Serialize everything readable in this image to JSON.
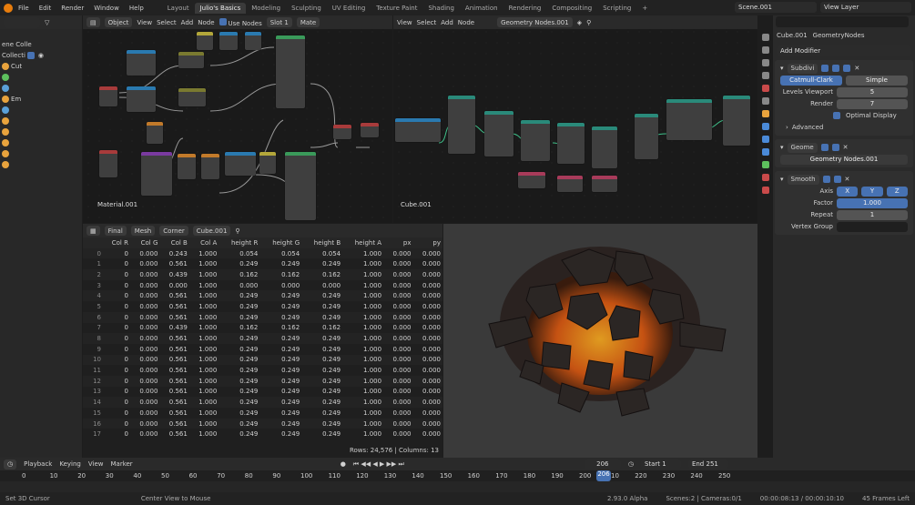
{
  "menu": [
    "File",
    "Edit",
    "Render",
    "Window",
    "Help"
  ],
  "tabs": [
    "Layout",
    "Julio's Basics",
    "Modeling",
    "Sculpting",
    "UV Editing",
    "Texture Paint",
    "Shading",
    "Animation",
    "Rendering",
    "Compositing",
    "Scripting"
  ],
  "scene": "Scene.001",
  "view_layer": "View Layer",
  "outliner": {
    "rows": [
      "ene Colle",
      "Collecti",
      "Cut",
      "",
      "",
      "Em",
      "",
      "",
      "",
      "",
      "",
      ""
    ]
  },
  "shader_editor": {
    "mode": "Object",
    "menus": [
      "View",
      "Select",
      "Add",
      "Node"
    ],
    "use_nodes": "Use Nodes",
    "slot": "Slot 1",
    "mat": "Mate",
    "label": "Material.001"
  },
  "geo_editor": {
    "menus": [
      "View",
      "Select",
      "Add",
      "Node"
    ],
    "tree": "Geometry Nodes.001",
    "label": "Cube.001"
  },
  "spreadsheet": {
    "mode": "Final",
    "domain": "Mesh",
    "attr": "Corner",
    "object": "Cube.001",
    "columns": [
      "Col R",
      "Col G",
      "Col B",
      "Col A",
      "height R",
      "height G",
      "height B",
      "height A",
      "px",
      "py"
    ],
    "rows": [
      [
        "0",
        "0.000",
        "0.243",
        "1.000",
        "0.054",
        "0.054",
        "0.054",
        "1.000",
        "0.000",
        "0.000"
      ],
      [
        "0",
        "0.000",
        "0.561",
        "1.000",
        "0.249",
        "0.249",
        "0.249",
        "1.000",
        "0.000",
        "0.000"
      ],
      [
        "0",
        "0.000",
        "0.439",
        "1.000",
        "0.162",
        "0.162",
        "0.162",
        "1.000",
        "0.000",
        "0.000"
      ],
      [
        "0",
        "0.000",
        "0.000",
        "1.000",
        "0.000",
        "0.000",
        "0.000",
        "1.000",
        "0.000",
        "0.000"
      ],
      [
        "0",
        "0.000",
        "0.561",
        "1.000",
        "0.249",
        "0.249",
        "0.249",
        "1.000",
        "0.000",
        "0.000"
      ],
      [
        "0",
        "0.000",
        "0.561",
        "1.000",
        "0.249",
        "0.249",
        "0.249",
        "1.000",
        "0.000",
        "0.000"
      ],
      [
        "0",
        "0.000",
        "0.561",
        "1.000",
        "0.249",
        "0.249",
        "0.249",
        "1.000",
        "0.000",
        "0.000"
      ],
      [
        "0",
        "0.000",
        "0.439",
        "1.000",
        "0.162",
        "0.162",
        "0.162",
        "1.000",
        "0.000",
        "0.000"
      ],
      [
        "0",
        "0.000",
        "0.561",
        "1.000",
        "0.249",
        "0.249",
        "0.249",
        "1.000",
        "0.000",
        "0.000"
      ],
      [
        "0",
        "0.000",
        "0.561",
        "1.000",
        "0.249",
        "0.249",
        "0.249",
        "1.000",
        "0.000",
        "0.000"
      ],
      [
        "0",
        "0.000",
        "0.561",
        "1.000",
        "0.249",
        "0.249",
        "0.249",
        "1.000",
        "0.000",
        "0.000"
      ],
      [
        "0",
        "0.000",
        "0.561",
        "1.000",
        "0.249",
        "0.249",
        "0.249",
        "1.000",
        "0.000",
        "0.000"
      ],
      [
        "0",
        "0.000",
        "0.561",
        "1.000",
        "0.249",
        "0.249",
        "0.249",
        "1.000",
        "0.000",
        "0.000"
      ],
      [
        "0",
        "0.000",
        "0.561",
        "1.000",
        "0.249",
        "0.249",
        "0.249",
        "1.000",
        "0.000",
        "0.000"
      ],
      [
        "0",
        "0.000",
        "0.561",
        "1.000",
        "0.249",
        "0.249",
        "0.249",
        "1.000",
        "0.000",
        "0.000"
      ],
      [
        "0",
        "0.000",
        "0.561",
        "1.000",
        "0.249",
        "0.249",
        "0.249",
        "1.000",
        "0.000",
        "0.000"
      ],
      [
        "0",
        "0.000",
        "0.561",
        "1.000",
        "0.249",
        "0.249",
        "0.249",
        "1.000",
        "0.000",
        "0.000"
      ],
      [
        "0",
        "0.000",
        "0.561",
        "1.000",
        "0.249",
        "0.249",
        "0.249",
        "1.000",
        "0.000",
        "0.000"
      ]
    ],
    "rows_label": "Rows: 24,576",
    "cols_label": "Columns: 13"
  },
  "properties": {
    "object": "Cube.001",
    "modifier_tab": "GeometryNodes",
    "add_modifier": "Add Modifier",
    "subdiv": {
      "name": "Subdivi",
      "type1": "Catmull-Clark",
      "type2": "Simple",
      "levels_label": "Levels Viewport",
      "levels": "5",
      "render_label": "Render",
      "render": "7",
      "optimal": "Optimal Display",
      "advanced": "Advanced"
    },
    "geo": {
      "name": "Geome",
      "tree": "Geometry Nodes.001"
    },
    "smooth": {
      "name": "Smooth",
      "axis_label": "Axis",
      "x": "X",
      "y": "Y",
      "z": "Z",
      "factor_label": "Factor",
      "factor": "1.000",
      "repeat_label": "Repeat",
      "repeat": "1",
      "vgroup_label": "Vertex Group"
    }
  },
  "timeline": {
    "menus": [
      "Playback",
      "Keying",
      "View",
      "Marker"
    ],
    "frame": "206",
    "start_label": "Start",
    "start": "1",
    "end_label": "End",
    "end": "251",
    "ticks": [
      "0",
      "10",
      "20",
      "30",
      "40",
      "50",
      "60",
      "70",
      "80",
      "90",
      "100",
      "110",
      "120",
      "130",
      "140",
      "150",
      "160",
      "170",
      "180",
      "190",
      "200",
      "210",
      "220",
      "230",
      "240",
      "250"
    ]
  },
  "status": {
    "left": "Set 3D Cursor",
    "mid": "Center View to Mouse",
    "version": "2.93.0 Alpha",
    "scenes": "Scenes:2 | Cameras:0/1",
    "time": "00:00:08:13 / 00:00:10:10",
    "frames": "45 Frames Left"
  }
}
